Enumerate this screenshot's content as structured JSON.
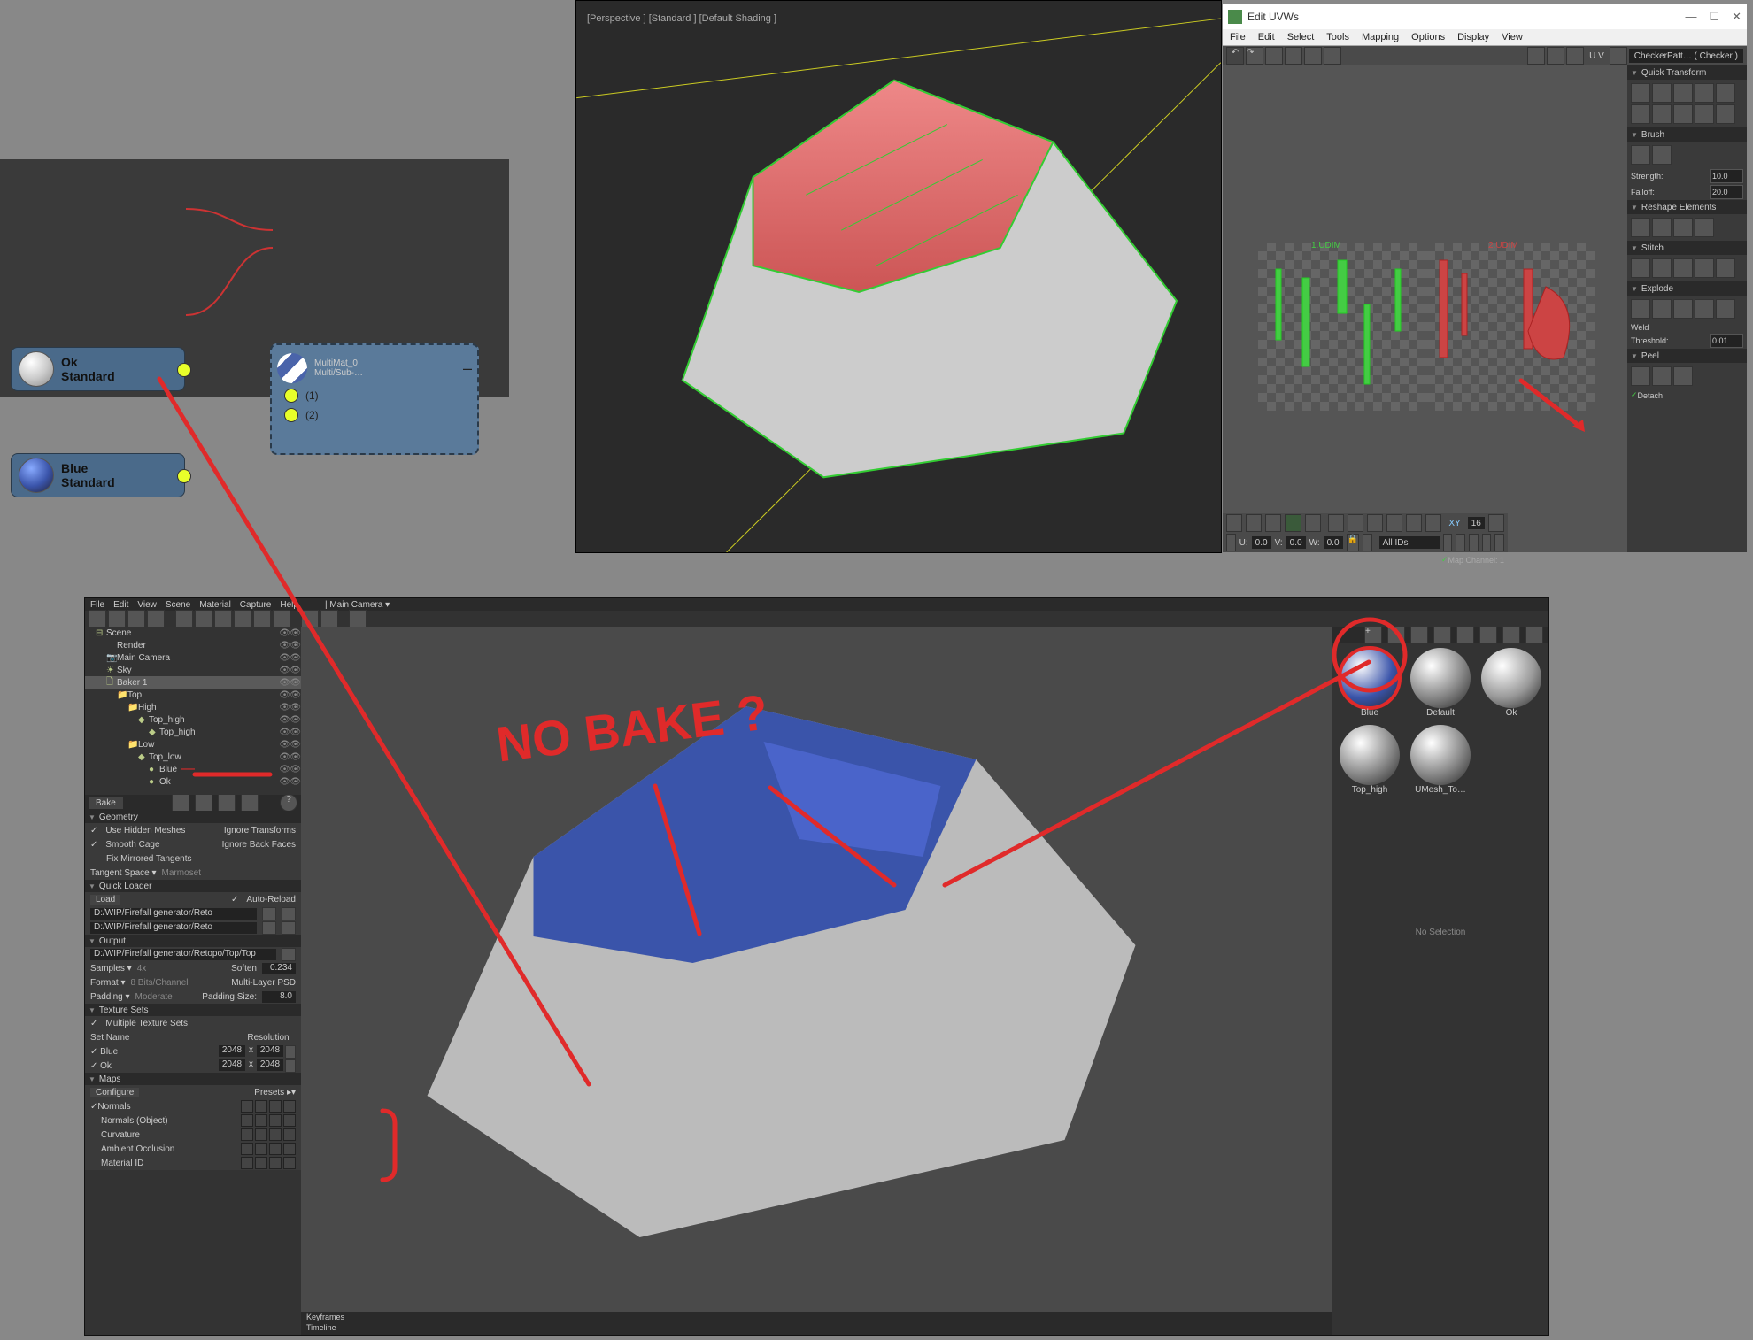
{
  "mat_editor": {
    "node_ok": {
      "name": "Ok",
      "type": "Standard"
    },
    "node_blue": {
      "name": "Blue",
      "type": "Standard"
    },
    "multimat": {
      "name": "MultiMat_0",
      "type": "Multi/Sub-…",
      "slots": [
        "(1)",
        "(2)"
      ]
    }
  },
  "max_viewport": {
    "info": "[Perspective ] [Standard ] [Default Shading ]"
  },
  "uv_editor": {
    "title": "Edit UVWs",
    "menu": [
      "File",
      "Edit",
      "Select",
      "Tools",
      "Mapping",
      "Options",
      "Display",
      "View"
    ],
    "checker_label": "CheckerPatt… ( Checker )",
    "uv_label": "U V",
    "udim_labels": [
      "1.UDIM",
      "2.UDIM"
    ],
    "quick_transform": "Quick Transform",
    "brush": "Brush",
    "brush_strength_lbl": "Strength:",
    "brush_strength": "10.0",
    "brush_falloff_lbl": "Falloff:",
    "brush_falloff": "20.0",
    "reshape": "Reshape Elements",
    "stitch": "Stitch",
    "explode": "Explode",
    "weld": "Weld",
    "threshold_lbl": "Threshold:",
    "threshold": "0.01",
    "peel": "Peel",
    "detach": "Detach",
    "status_u": "U:",
    "status_u_v": "0.0",
    "status_v": "V:",
    "status_v_v": "0.0",
    "status_w": "W:",
    "status_w_v": "0.0",
    "xy": "XY",
    "xy_v": "16",
    "all_ids": "All IDs",
    "map_channel": "Map Channel: 1"
  },
  "marmoset": {
    "menu": [
      "File",
      "Edit",
      "View",
      "Scene",
      "Material",
      "Capture",
      "Help"
    ],
    "camera": "Main Camera ▾",
    "scene": [
      {
        "d": 0,
        "i": "⊟",
        "n": "Scene"
      },
      {
        "d": 1,
        "i": " ",
        "n": "Render"
      },
      {
        "d": 1,
        "i": "📷",
        "n": "Main Camera"
      },
      {
        "d": 1,
        "i": "☀",
        "n": "Sky"
      },
      {
        "d": 1,
        "i": "🗋",
        "n": "Baker 1",
        "sel": true
      },
      {
        "d": 2,
        "i": "📁",
        "n": "Top"
      },
      {
        "d": 3,
        "i": "📁",
        "n": "High"
      },
      {
        "d": 4,
        "i": "◆",
        "n": "Top_high"
      },
      {
        "d": 5,
        "i": "◆",
        "n": "Top_high"
      },
      {
        "d": 3,
        "i": "📁",
        "n": "Low"
      },
      {
        "d": 4,
        "i": "◆",
        "n": "Top_low"
      },
      {
        "d": 5,
        "i": "●",
        "n": "Blue",
        "mark": true
      },
      {
        "d": 5,
        "i": "●",
        "n": "Ok"
      }
    ],
    "bake_btn": "Bake",
    "geometry": "Geometry",
    "use_hidden": "Use Hidden Meshes",
    "ignore_trans": "Ignore Transforms",
    "smooth_cage": "Smooth Cage",
    "ignore_back": "Ignore Back Faces",
    "fix_mirror": "Fix Mirrored Tangents",
    "tangent_lbl": "Tangent Space ▾",
    "tangent": "Marmoset",
    "quick_loader": "Quick Loader",
    "load": "Load",
    "auto_reload": "Auto-Reload",
    "path1": "D:/WIP/Firefall generator/Reto",
    "path2": "D:/WIP/Firefall generator/Reto",
    "output": "Output",
    "out_path": "D:/WIP/Firefall generator/Retopo/Top/Top",
    "samples_lbl": "Samples ▾",
    "samples": "4x",
    "soften_lbl": "Soften",
    "soften": "0.234",
    "format_lbl": "Format ▾",
    "format": "8 Bits/Channel",
    "multipsd": "Multi-Layer PSD",
    "padding_lbl": "Padding ▾",
    "padding": "Moderate",
    "padsize_lbl": "Padding Size:",
    "padsize": "8.0",
    "texture_sets": "Texture Sets",
    "multi_sets": "Multiple Texture Sets",
    "setname": "Set Name",
    "resolution": "Resolution",
    "sets": [
      {
        "n": "Blue",
        "w": "2048",
        "h": "2048"
      },
      {
        "n": "Ok",
        "w": "2048",
        "h": "2048"
      }
    ],
    "maps": "Maps",
    "configure": "Configure",
    "presets": "Presets ▸▾",
    "map_list": [
      {
        "n": "Normals",
        "c": true
      },
      {
        "n": "Normals (Object)",
        "c": false
      },
      {
        "n": "Curvature",
        "c": false
      },
      {
        "n": "Ambient Occlusion",
        "c": false
      },
      {
        "n": "Material ID",
        "c": false
      }
    ],
    "materials": [
      {
        "n": "Blue",
        "c": "#3a54aa",
        "sel": true
      },
      {
        "n": "Default",
        "c": "grad"
      },
      {
        "n": "Ok",
        "c": "#999"
      },
      {
        "n": "Top_high",
        "c": "#888"
      },
      {
        "n": "UMesh_To…",
        "c": "#888"
      }
    ],
    "no_selection": "No Selection",
    "timeline": {
      "kf": "Keyframes",
      "tl": "Timeline"
    }
  },
  "annotation": {
    "text": "NO BAKE ?"
  }
}
